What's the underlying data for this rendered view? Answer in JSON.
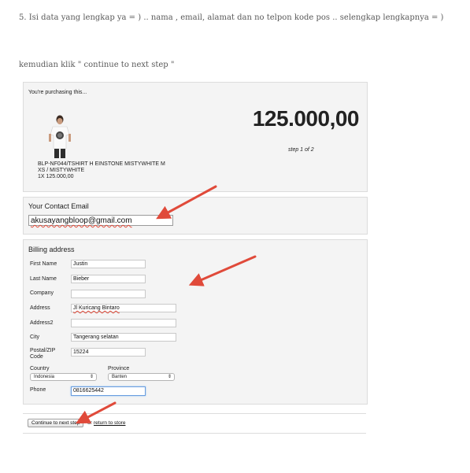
{
  "blog": {
    "line1": "5. Isi data yang lengkap ya = ) .. nama , email, alamat dan no telpon kode pos  .. selengkap lengkapnya  = )",
    "line2": "kemudian klik \" continue to next step \""
  },
  "order": {
    "purchasing_label": "You're purchasing this...",
    "product_line1": "BLP-NF044/TSHIRT H EINSTONE MISTYWHITE M",
    "product_line2": "XS / MISTYWHITE",
    "product_line3": "1x 125.000,00",
    "total": "125.000,00",
    "step": "step 1 of 2"
  },
  "contact": {
    "title": "Your Contact Email",
    "email_value": "akusayangbloop@gmail.com"
  },
  "billing": {
    "title": "Billing address",
    "fields": [
      {
        "label": "First Name",
        "value": "Justin"
      },
      {
        "label": "Last Name",
        "value": "Bieber"
      },
      {
        "label": "Company",
        "value": ""
      },
      {
        "label": "Address",
        "value": "Jl Kuricang Bintaro"
      },
      {
        "label": "Address2",
        "value": ""
      },
      {
        "label": "City",
        "value": "Tangerang selatan"
      },
      {
        "label": "Postal/ZIP Code",
        "value": "15224"
      }
    ],
    "country_label": "Country",
    "country_value": "Indonesia",
    "province_label": "Province",
    "province_value": "Banten",
    "phone_label": "Phone",
    "phone_value": "0816625442"
  },
  "footer": {
    "continue_label": "Continue to next step",
    "or_text": "or",
    "return_label": "return to store"
  },
  "colors": {
    "arrow": "#e04a3a",
    "panel_bg": "#f4f4f4"
  }
}
